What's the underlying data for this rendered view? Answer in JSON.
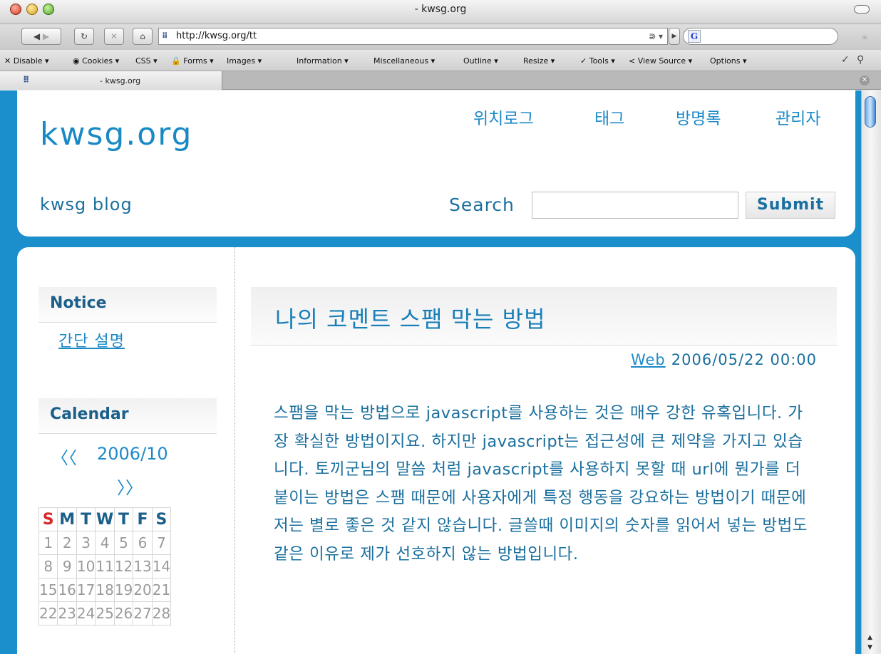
{
  "window": {
    "title": "- kwsg.org"
  },
  "navbar": {
    "url": "http://kwsg.org/tt",
    "url_icons": "⋑ ▾",
    "search_engine": "G"
  },
  "devtoolbar": {
    "items": [
      "✕ Disable ▾",
      "◉ Cookies ▾",
      "CSS ▾",
      "🔒 Forms ▾",
      "Images ▾",
      "Information ▾",
      "Miscellaneous ▾",
      "Outline ▾",
      "Resize ▾",
      "✓ Tools ▾",
      "< View Source ▾",
      "Options ▾"
    ]
  },
  "tab": {
    "title": "- kwsg.org"
  },
  "site": {
    "title": "kwsg.org",
    "tagline": "kwsg blog",
    "nav": [
      "위치로그",
      "태그",
      "방명록",
      "관리자"
    ],
    "search_label": "Search",
    "search_value": "",
    "submit_label": "Submit"
  },
  "sidebar": {
    "notice": {
      "heading": "Notice",
      "link": "간단 설명"
    },
    "calendar": {
      "heading": "Calendar",
      "prev": "〈〈",
      "month": "2006/10",
      "next": "〉〉",
      "days": [
        "S",
        "M",
        "T",
        "W",
        "T",
        "F",
        "S"
      ],
      "weeks": [
        [
          "1",
          "2",
          "3",
          "4",
          "5",
          "6",
          "7"
        ],
        [
          "8",
          "9",
          "10",
          "11",
          "12",
          "13",
          "14"
        ],
        [
          "15",
          "16",
          "17",
          "18",
          "19",
          "20",
          "21"
        ],
        [
          "22",
          "23",
          "24",
          "25",
          "26",
          "27",
          "28"
        ]
      ]
    }
  },
  "post": {
    "title": "나의 코멘트 스팸 막는 방법",
    "category": "Web",
    "date": "2006/05/22 00:00",
    "body": "스팸을 막는 방법으로 javascript를 사용하는 것은 매우 강한 유혹입니다. 가장 확실한 방법이지요. 하지만 javascript는 접근성에 큰 제약을 가지고 있습니다. 토끼군님의 말씀 처럼 javascript를 사용하지 못할 때 url에 뭔가를 더 붙이는 방법은 스팸 때문에 사용자에게 특정 행동을 강요하는 방법이기 때문에 저는 별로 좋은 것 같지 않습니다. 글쓸때 이미지의 숫자를 읽어서 넣는 방법도 같은 이유로 제가 선호하지 않는 방법입니다."
  }
}
